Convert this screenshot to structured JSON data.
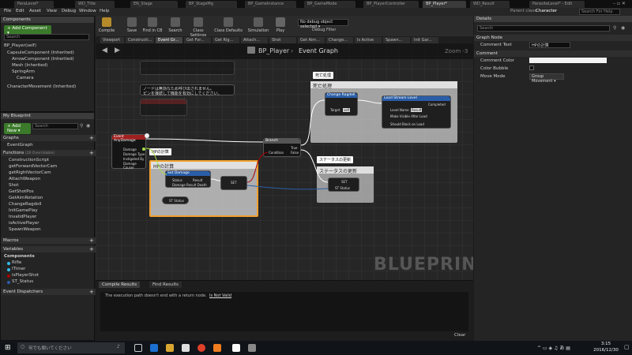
{
  "tabs": [
    "ParaLevel*",
    "WD_Title",
    "EN_Stage",
    "BP_StageMg",
    "BP_GameInstance",
    "BP_GameMode",
    "BP_PlayerController",
    "BP_Player*",
    "WD_Result",
    "ParasiteLevel* - Edit"
  ],
  "menu": [
    "File",
    "Edit",
    "Asset",
    "View",
    "Debug",
    "Window",
    "Help"
  ],
  "parent_class_label": "Parent class:",
  "parent_class_value": "Character",
  "search_help_placeholder": "Search For Help",
  "toolbar": {
    "compile": "Compile",
    "save": "Save",
    "find_in_cb": "Find in CB",
    "search": "Search",
    "class_settings": "Class Settings",
    "class_defaults": "Class Defaults",
    "simulation": "Simulation",
    "play": "Play",
    "debug_select": "No debug object selected ▾",
    "debug_filter": "Debug Filter"
  },
  "components_panel": {
    "title": "Components",
    "add_button": "+ Add Component ▾",
    "search_placeholder": "Search",
    "self": "BP_Player(self)",
    "items": [
      "CapsuleComponent (Inherited)",
      "ArrowComponent (Inherited)",
      "Mesh (Inherited)",
      "SpringArm",
      "Camera",
      "CharacterMovement (Inherited)"
    ]
  },
  "my_blueprint": {
    "title": "My Blueprint",
    "add_new": "+ Add New ▾",
    "search_placeholder": "Search",
    "graphs_label": "Graphs",
    "event_graph": "EventGraph",
    "functions_label": "Functions",
    "functions_count": "(20 Overridable)",
    "functions": [
      "ConstructionScript",
      "getForwardVectorCam",
      "getRightVectorCam",
      "AttachWeapon",
      "Shot",
      "GetShotPos",
      "GetAimRotation",
      "ChangeRagdoll",
      "InitGamePlay",
      "InvalidPlayer",
      "isActivePlayer",
      "SpawnWeapon"
    ],
    "macros_label": "Macros",
    "variables_label": "Variables",
    "components_label": "Components",
    "variables": [
      "Rifle",
      "ITimer",
      "isPlayerShot",
      "ST_Status"
    ],
    "event_dispatchers_label": "Event Dispatchers"
  },
  "subtabs": [
    "Viewport",
    "Constructi...",
    "Event Gr...",
    "Get For...",
    "Get Rig...",
    "Attach...",
    "Shot",
    "Get Aim...",
    "Change...",
    "Is Active",
    "Spawn...",
    "Init Gar..."
  ],
  "graph": {
    "breadcrumb": "BP_Player",
    "breadcrumb_sep": "›",
    "graph_name": "Event Graph",
    "zoom": "Zoom -3",
    "watermark": "BLUEPRINT",
    "note_1": "ノードは無効なため呼び出されません。",
    "note_2": "ピンを接続して機能を有効にしてください。",
    "event_node": "Event AnyDamage",
    "event_pins": [
      "Damage",
      "Damage Type",
      "Instigated By",
      "Damage Causer"
    ],
    "branch_node": "Branch",
    "branch_pins": [
      "Condition",
      "True",
      "False"
    ],
    "comment_hp": "HPの計算",
    "comment_death": "死亡処理",
    "comment_status": "ステータスの更新",
    "bubble_hp": "HPの計算",
    "bubble_death": "死亡処理",
    "bubble_status": "ステータスの更新",
    "set_damage_node": "Set Damage",
    "set_damage_pins": [
      "Status",
      "Damage",
      "Result",
      "Result Death"
    ],
    "change_ragdoll_node": "Change Ragdoll",
    "target_label": "Target",
    "target_value": "self",
    "load_stream_node": "Load Stream Level",
    "load_stream_pins": [
      "Level Name",
      "Make Visible After Load",
      "Should Block on Load",
      "Completed"
    ],
    "load_stream_value": "Result",
    "set_node": "SET",
    "st_status": "ST Status",
    "st_status_2": "ST Status"
  },
  "results": {
    "tab_compile": "Compile Results",
    "tab_find": "Find Results",
    "message": "The execution path doesn't end with a return node.",
    "link": "Is Not Valid",
    "clear": "Clear"
  },
  "details": {
    "title": "Details",
    "search_placeholder": "Search",
    "graph_node_label": "Graph Node",
    "comment_text_label": "Comment Text",
    "comment_text_value": "HPの計算",
    "comment_section": "Comment",
    "comment_color_label": "Comment Color",
    "color_bubble_label": "Color Bubble",
    "move_mode_label": "Move Mode",
    "move_mode_value": "Group Movement ▾"
  },
  "taskbar": {
    "search_placeholder": "何でも聞いてください",
    "time": "3:15",
    "date": "2016/12/30"
  },
  "colors": {
    "accent_green": "#3a7a2a",
    "selection_orange": "#f0a030",
    "event_red": "#a02020",
    "function_blue": "#2b5ea8",
    "background_dark": "#1b1b1b"
  }
}
